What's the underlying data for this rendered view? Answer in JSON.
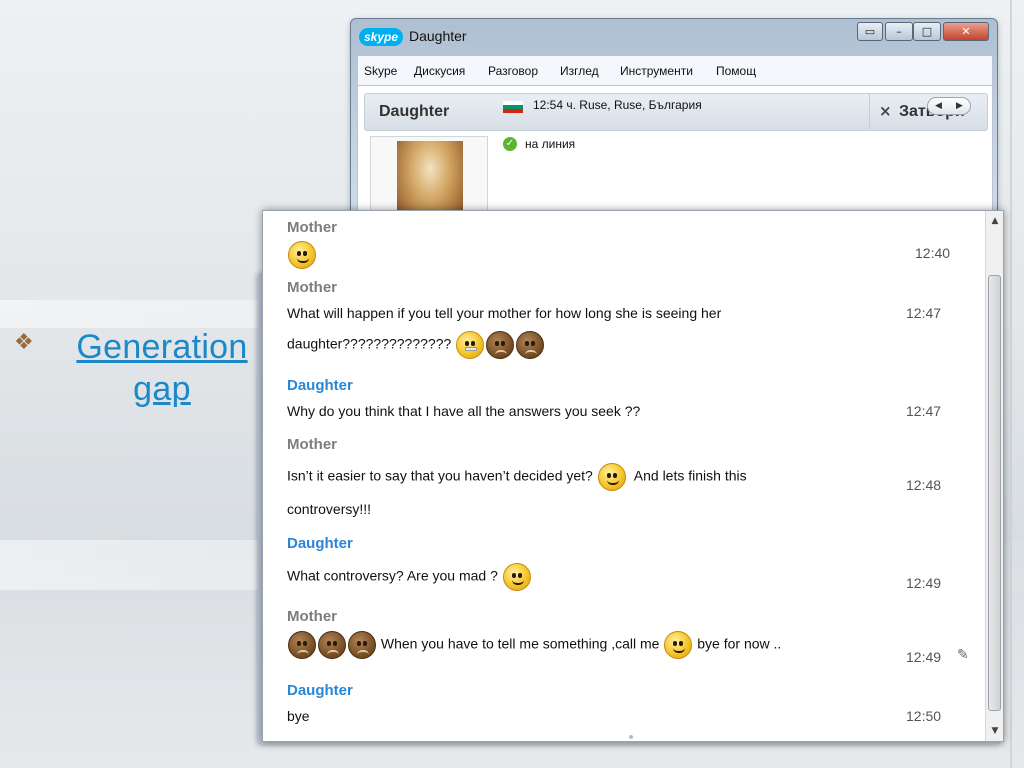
{
  "slide": {
    "bullet_glyph": "❖",
    "bullet_text_line1": "Generation",
    "bullet_text_line2": "gap"
  },
  "window": {
    "logo_text": "skype",
    "title": "Daughter",
    "buttons": {
      "restore": "▭",
      "minimize": "–",
      "maximize": "□",
      "close": "✕"
    }
  },
  "menu": [
    "Skype",
    "Дискусия",
    "Разговор",
    "Изглед",
    "Инструменти",
    "Помощ"
  ],
  "contact": {
    "name": "Daughter",
    "close_label": "Затвори",
    "close_icon": "×",
    "location": "12:54 ч. Ruse, Ruse, България",
    "status": "на линия",
    "status_icon": "✓",
    "flag_colors": [
      "#ffffff",
      "#00966e",
      "#d62612"
    ]
  },
  "scrollbar": {
    "up": "▲",
    "down": "▼"
  },
  "messages": [
    {
      "sender": "Mother",
      "lines": [
        ""
      ],
      "time": "12:40"
    },
    {
      "sender": "Mother",
      "lines": [
        "What will happen if you tell your mother for how long she is seeing her",
        "daughter??????????????"
      ],
      "time": "12:47"
    },
    {
      "sender": "Daughter",
      "lines": [
        "Why do you think that I have all the answers you seek ??"
      ],
      "time": "12:47"
    },
    {
      "sender": "Mother",
      "lines": [
        " Isn’t it easier to say that you haven’t decided yet?",
        "And lets finish this",
        "controversy!!!"
      ],
      "time": "12:48"
    },
    {
      "sender": "Daughter",
      "lines": [
        "What controversy? Are you mad ?"
      ],
      "time": "12:49"
    },
    {
      "sender": "Mother",
      "lines": [
        "When you have to tell me something ,call me",
        "bye for now  .."
      ],
      "time": "12:49",
      "edit_mark": "✎"
    },
    {
      "sender": "Daughter",
      "lines": [
        "bye"
      ],
      "time": "12:50"
    }
  ]
}
